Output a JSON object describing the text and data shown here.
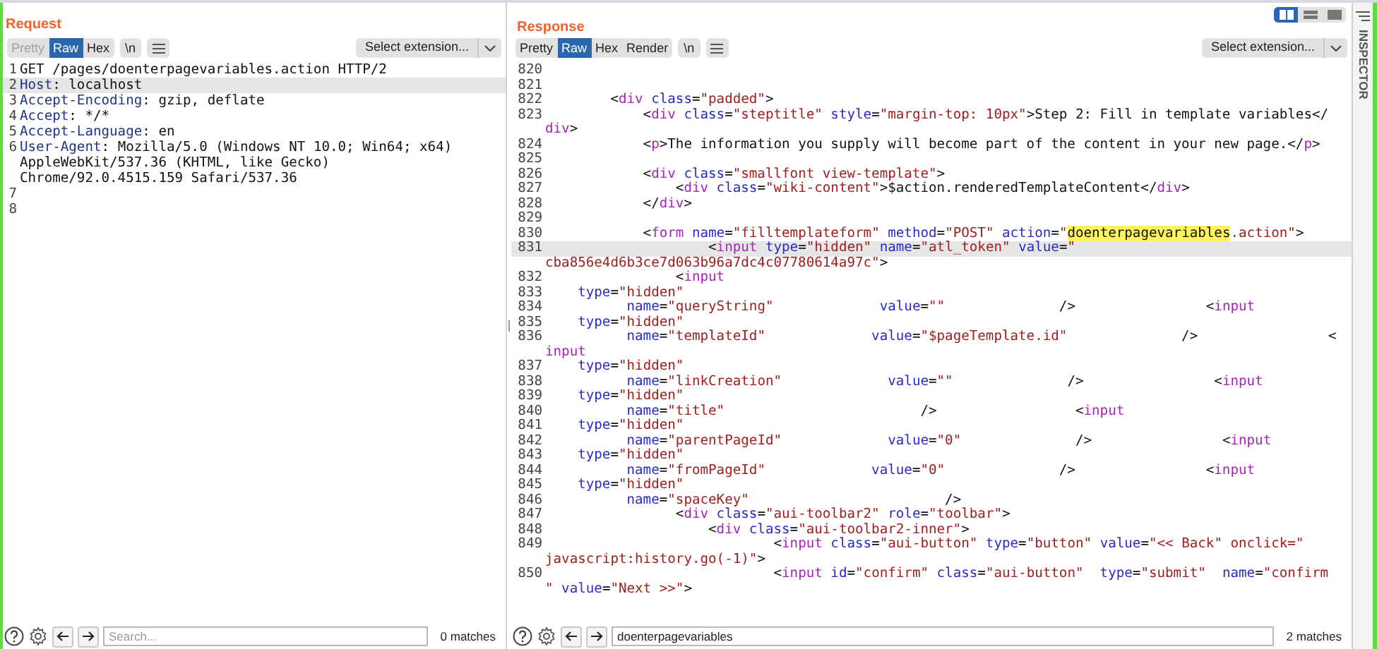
{
  "request": {
    "title": "Request",
    "view_tabs": [
      {
        "label": "Pretty",
        "selected": false,
        "disabled": true
      },
      {
        "label": "Raw",
        "selected": true,
        "disabled": false
      },
      {
        "label": "Hex",
        "selected": false,
        "disabled": false
      }
    ],
    "newline_button": "\\n",
    "extension_select": "Select extension...",
    "lines": [
      {
        "number": "1",
        "current": false,
        "rows": [
          {
            "tokens": [
              {
                "kind": "plain",
                "text": "GET /pages/doenterpagevariables.action HTTP/2"
              }
            ]
          }
        ]
      },
      {
        "number": "2",
        "current": true,
        "rows": [
          {
            "tokens": [
              {
                "kind": "header",
                "text": "Host"
              },
              {
                "kind": "plain",
                "text": ": localhost"
              }
            ]
          }
        ]
      },
      {
        "number": "3",
        "current": false,
        "rows": [
          {
            "tokens": [
              {
                "kind": "header",
                "text": "Accept-Encoding"
              },
              {
                "kind": "plain",
                "text": ": gzip, deflate"
              }
            ]
          }
        ]
      },
      {
        "number": "4",
        "current": false,
        "rows": [
          {
            "tokens": [
              {
                "kind": "header",
                "text": "Accept"
              },
              {
                "kind": "plain",
                "text": ": */*"
              }
            ]
          }
        ]
      },
      {
        "number": "5",
        "current": false,
        "rows": [
          {
            "tokens": [
              {
                "kind": "header",
                "text": "Accept-Language"
              },
              {
                "kind": "plain",
                "text": ": en"
              }
            ]
          }
        ]
      },
      {
        "number": "6",
        "current": false,
        "rows": [
          {
            "tokens": [
              {
                "kind": "header",
                "text": "User-Agent"
              },
              {
                "kind": "plain",
                "text": ": Mozilla/5.0 (Windows NT 10.0; Win64; x64)"
              }
            ]
          },
          {
            "tokens": [
              {
                "kind": "plain",
                "text": "AppleWebKit/537.36 (KHTML, like Gecko)"
              }
            ]
          },
          {
            "tokens": [
              {
                "kind": "plain",
                "text": "Chrome/92.0.4515.159 Safari/537.36"
              }
            ]
          }
        ]
      },
      {
        "number": "7",
        "current": false
      },
      {
        "number": "8",
        "current": false
      }
    ],
    "search": {
      "placeholder": "Search...",
      "matches": "0 matches"
    }
  },
  "response": {
    "title": "Response",
    "layout_buttons": [
      {
        "kind": "columns",
        "selected": true
      },
      {
        "kind": "rows",
        "selected": false
      },
      {
        "kind": "single",
        "selected": false
      }
    ],
    "view_tabs": [
      {
        "label": "Pretty",
        "selected": false,
        "disabled": false
      },
      {
        "label": "Raw",
        "selected": true,
        "disabled": false
      },
      {
        "label": "Hex",
        "selected": false,
        "disabled": false
      },
      {
        "label": "Render",
        "selected": false,
        "disabled": false
      }
    ],
    "newline_button": "\\n",
    "extension_select": "Select extension...",
    "lines": [
      {
        "number": "820",
        "current": false
      },
      {
        "number": "821",
        "current": false
      },
      {
        "number": "822",
        "current": false,
        "rows": [
          {
            "tokens": [
              {
                "kind": "plain",
                "text": "        <"
              },
              {
                "kind": "tag",
                "text": "div"
              },
              {
                "kind": "attr",
                "text": " class"
              },
              {
                "kind": "plain",
                "text": "="
              },
              {
                "kind": "string",
                "text": "\"padded\""
              },
              {
                "kind": "plain",
                "text": ">"
              }
            ]
          }
        ]
      },
      {
        "number": "823",
        "current": false,
        "rows": [
          {
            "tokens": [
              {
                "kind": "plain",
                "text": "            <"
              },
              {
                "kind": "tag",
                "text": "div"
              },
              {
                "kind": "attr",
                "text": " class"
              },
              {
                "kind": "plain",
                "text": "="
              },
              {
                "kind": "string",
                "text": "\"steptitle\""
              },
              {
                "kind": "attr",
                "text": " style"
              },
              {
                "kind": "plain",
                "text": "="
              },
              {
                "kind": "string",
                "text": "\"margin-top: 10px\""
              },
              {
                "kind": "plain",
                "text": ">Step 2: Fill in template variables</"
              }
            ]
          },
          {
            "tokens": [
              {
                "kind": "tag",
                "text": "div"
              },
              {
                "kind": "plain",
                "text": ">"
              }
            ]
          }
        ]
      },
      {
        "number": "824",
        "current": false,
        "rows": [
          {
            "tokens": [
              {
                "kind": "plain",
                "text": "            <"
              },
              {
                "kind": "tag",
                "text": "p"
              },
              {
                "kind": "plain",
                "text": ">The information you supply will become part of the content in your new page.</"
              },
              {
                "kind": "tag",
                "text": "p"
              },
              {
                "kind": "plain",
                "text": ">"
              }
            ]
          }
        ]
      },
      {
        "number": "825",
        "current": false
      },
      {
        "number": "826",
        "current": false,
        "rows": [
          {
            "tokens": [
              {
                "kind": "plain",
                "text": "            <"
              },
              {
                "kind": "tag",
                "text": "div"
              },
              {
                "kind": "attr",
                "text": " class"
              },
              {
                "kind": "plain",
                "text": "="
              },
              {
                "kind": "string",
                "text": "\"smallfont view-template\""
              },
              {
                "kind": "plain",
                "text": ">"
              }
            ]
          }
        ]
      },
      {
        "number": "827",
        "current": false,
        "rows": [
          {
            "tokens": [
              {
                "kind": "plain",
                "text": "                <"
              },
              {
                "kind": "tag",
                "text": "div"
              },
              {
                "kind": "attr",
                "text": " class"
              },
              {
                "kind": "plain",
                "text": "="
              },
              {
                "kind": "string",
                "text": "\"wiki-content\""
              },
              {
                "kind": "plain",
                "text": ">$action.renderedTemplateContent</"
              },
              {
                "kind": "tag",
                "text": "div"
              },
              {
                "kind": "plain",
                "text": ">"
              }
            ]
          }
        ]
      },
      {
        "number": "828",
        "current": false,
        "rows": [
          {
            "tokens": [
              {
                "kind": "plain",
                "text": "            </"
              },
              {
                "kind": "tag",
                "text": "div"
              },
              {
                "kind": "plain",
                "text": ">"
              }
            ]
          }
        ]
      },
      {
        "number": "829",
        "current": false
      },
      {
        "number": "830",
        "current": false,
        "rows": [
          {
            "tokens": [
              {
                "kind": "plain",
                "text": "            <"
              },
              {
                "kind": "tag",
                "text": "form"
              },
              {
                "kind": "attr",
                "text": " name"
              },
              {
                "kind": "plain",
                "text": "="
              },
              {
                "kind": "string",
                "text": "\"filltemplateform\""
              },
              {
                "kind": "attr",
                "text": " method"
              },
              {
                "kind": "plain",
                "text": "="
              },
              {
                "kind": "string",
                "text": "\"POST\""
              },
              {
                "kind": "attr",
                "text": " action"
              },
              {
                "kind": "plain",
                "text": "="
              },
              {
                "kind": "string",
                "text": "\""
              },
              {
                "kind": "match",
                "text": "doenterpagevariables"
              },
              {
                "kind": "string",
                "text": ".action\""
              },
              {
                "kind": "plain",
                "text": ">"
              }
            ]
          }
        ]
      },
      {
        "number": "831",
        "current": true,
        "rows": [
          {
            "tokens": [
              {
                "kind": "plain",
                "text": "                    <"
              },
              {
                "kind": "tag",
                "text": "input"
              },
              {
                "kind": "attr",
                "text": " type"
              },
              {
                "kind": "plain",
                "text": "="
              },
              {
                "kind": "string",
                "text": "\"hidden\""
              },
              {
                "kind": "attr",
                "text": " name"
              },
              {
                "kind": "plain",
                "text": "="
              },
              {
                "kind": "string",
                "text": "\"atl_token\""
              },
              {
                "kind": "attr",
                "text": " value"
              },
              {
                "kind": "plain",
                "text": "="
              },
              {
                "kind": "string",
                "text": "\""
              }
            ]
          },
          {
            "tokens": [
              {
                "kind": "string",
                "text": "cba856e4d6b3ce7d063b96a7dc4c07780614a97c\""
              },
              {
                "kind": "plain",
                "text": ">"
              }
            ]
          }
        ]
      },
      {
        "number": "832",
        "current": false,
        "rows": [
          {
            "tokens": [
              {
                "kind": "plain",
                "text": "                <"
              },
              {
                "kind": "tag",
                "text": "input"
              }
            ]
          }
        ]
      },
      {
        "number": "833",
        "current": false,
        "rows": [
          {
            "tokens": [
              {
                "kind": "attr",
                "text": "    type"
              },
              {
                "kind": "plain",
                "text": "="
              },
              {
                "kind": "string",
                "text": "\"hidden\""
              }
            ]
          }
        ]
      },
      {
        "number": "834",
        "current": false,
        "rows": [
          {
            "tokens": [
              {
                "kind": "attr",
                "text": "          name"
              },
              {
                "kind": "plain",
                "text": "="
              },
              {
                "kind": "string",
                "text": "\"queryString\""
              },
              {
                "kind": "attr",
                "text": "             value"
              },
              {
                "kind": "plain",
                "text": "="
              },
              {
                "kind": "string",
                "text": "\"\""
              },
              {
                "kind": "plain",
                "text": "              />                <"
              },
              {
                "kind": "tag",
                "text": "input"
              }
            ]
          }
        ]
      },
      {
        "number": "835",
        "current": false,
        "rows": [
          {
            "tokens": [
              {
                "kind": "attr",
                "text": "    type"
              },
              {
                "kind": "plain",
                "text": "="
              },
              {
                "kind": "string",
                "text": "\"hidden\""
              }
            ]
          }
        ]
      },
      {
        "number": "836",
        "current": false,
        "rows": [
          {
            "tokens": [
              {
                "kind": "attr",
                "text": "          name"
              },
              {
                "kind": "plain",
                "text": "="
              },
              {
                "kind": "string",
                "text": "\"templateId\""
              },
              {
                "kind": "attr",
                "text": "             value"
              },
              {
                "kind": "plain",
                "text": "="
              },
              {
                "kind": "string",
                "text": "\"$pageTemplate.id\""
              },
              {
                "kind": "plain",
                "text": "              />                <"
              }
            ]
          },
          {
            "tokens": [
              {
                "kind": "tag",
                "text": "input"
              }
            ]
          }
        ]
      },
      {
        "number": "837",
        "current": false,
        "rows": [
          {
            "tokens": [
              {
                "kind": "attr",
                "text": "    type"
              },
              {
                "kind": "plain",
                "text": "="
              },
              {
                "kind": "string",
                "text": "\"hidden\""
              }
            ]
          }
        ]
      },
      {
        "number": "838",
        "current": false,
        "rows": [
          {
            "tokens": [
              {
                "kind": "attr",
                "text": "          name"
              },
              {
                "kind": "plain",
                "text": "="
              },
              {
                "kind": "string",
                "text": "\"linkCreation\""
              },
              {
                "kind": "attr",
                "text": "             value"
              },
              {
                "kind": "plain",
                "text": "="
              },
              {
                "kind": "string",
                "text": "\"\""
              },
              {
                "kind": "plain",
                "text": "              />                <"
              },
              {
                "kind": "tag",
                "text": "input"
              }
            ]
          }
        ]
      },
      {
        "number": "839",
        "current": false,
        "rows": [
          {
            "tokens": [
              {
                "kind": "attr",
                "text": "    type"
              },
              {
                "kind": "plain",
                "text": "="
              },
              {
                "kind": "string",
                "text": "\"hidden\""
              }
            ]
          }
        ]
      },
      {
        "number": "840",
        "current": false,
        "rows": [
          {
            "tokens": [
              {
                "kind": "attr",
                "text": "          name"
              },
              {
                "kind": "plain",
                "text": "="
              },
              {
                "kind": "string",
                "text": "\"title\""
              },
              {
                "kind": "plain",
                "text": "                        />                 <"
              },
              {
                "kind": "tag",
                "text": "input"
              }
            ]
          }
        ]
      },
      {
        "number": "841",
        "current": false,
        "rows": [
          {
            "tokens": [
              {
                "kind": "attr",
                "text": "    type"
              },
              {
                "kind": "plain",
                "text": "="
              },
              {
                "kind": "string",
                "text": "\"hidden\""
              }
            ]
          }
        ]
      },
      {
        "number": "842",
        "current": false,
        "rows": [
          {
            "tokens": [
              {
                "kind": "attr",
                "text": "          name"
              },
              {
                "kind": "plain",
                "text": "="
              },
              {
                "kind": "string",
                "text": "\"parentPageId\""
              },
              {
                "kind": "attr",
                "text": "             value"
              },
              {
                "kind": "plain",
                "text": "="
              },
              {
                "kind": "string",
                "text": "\"0\""
              },
              {
                "kind": "plain",
                "text": "              />                <"
              },
              {
                "kind": "tag",
                "text": "input"
              }
            ]
          }
        ]
      },
      {
        "number": "843",
        "current": false,
        "rows": [
          {
            "tokens": [
              {
                "kind": "attr",
                "text": "    type"
              },
              {
                "kind": "plain",
                "text": "="
              },
              {
                "kind": "string",
                "text": "\"hidden\""
              }
            ]
          }
        ]
      },
      {
        "number": "844",
        "current": false,
        "rows": [
          {
            "tokens": [
              {
                "kind": "attr",
                "text": "          name"
              },
              {
                "kind": "plain",
                "text": "="
              },
              {
                "kind": "string",
                "text": "\"fromPageId\""
              },
              {
                "kind": "attr",
                "text": "             value"
              },
              {
                "kind": "plain",
                "text": "="
              },
              {
                "kind": "string",
                "text": "\"0\""
              },
              {
                "kind": "plain",
                "text": "              />                <"
              },
              {
                "kind": "tag",
                "text": "input"
              }
            ]
          }
        ]
      },
      {
        "number": "845",
        "current": false,
        "rows": [
          {
            "tokens": [
              {
                "kind": "attr",
                "text": "    type"
              },
              {
                "kind": "plain",
                "text": "="
              },
              {
                "kind": "string",
                "text": "\"hidden\""
              }
            ]
          }
        ]
      },
      {
        "number": "846",
        "current": false,
        "rows": [
          {
            "tokens": [
              {
                "kind": "attr",
                "text": "          name"
              },
              {
                "kind": "plain",
                "text": "="
              },
              {
                "kind": "string",
                "text": "\"spaceKey\""
              },
              {
                "kind": "plain",
                "text": "                        />"
              }
            ]
          }
        ]
      },
      {
        "number": "847",
        "current": false,
        "rows": [
          {
            "tokens": [
              {
                "kind": "plain",
                "text": "                <"
              },
              {
                "kind": "tag",
                "text": "div"
              },
              {
                "kind": "attr",
                "text": " class"
              },
              {
                "kind": "plain",
                "text": "="
              },
              {
                "kind": "string",
                "text": "\"aui-toolbar2\""
              },
              {
                "kind": "attr",
                "text": " role"
              },
              {
                "kind": "plain",
                "text": "="
              },
              {
                "kind": "string",
                "text": "\"toolbar\""
              },
              {
                "kind": "plain",
                "text": ">"
              }
            ]
          }
        ]
      },
      {
        "number": "848",
        "current": false,
        "rows": [
          {
            "tokens": [
              {
                "kind": "plain",
                "text": "                    <"
              },
              {
                "kind": "tag",
                "text": "div"
              },
              {
                "kind": "attr",
                "text": " class"
              },
              {
                "kind": "plain",
                "text": "="
              },
              {
                "kind": "string",
                "text": "\"aui-toolbar2-inner\""
              },
              {
                "kind": "plain",
                "text": ">"
              }
            ]
          }
        ]
      },
      {
        "number": "849",
        "current": false,
        "rows": [
          {
            "tokens": [
              {
                "kind": "plain",
                "text": "                            <"
              },
              {
                "kind": "tag",
                "text": "input"
              },
              {
                "kind": "attr",
                "text": " class"
              },
              {
                "kind": "plain",
                "text": "="
              },
              {
                "kind": "string",
                "text": "\"aui-button\""
              },
              {
                "kind": "attr",
                "text": " type"
              },
              {
                "kind": "plain",
                "text": "="
              },
              {
                "kind": "string",
                "text": "\"button\""
              },
              {
                "kind": "attr",
                "text": " value"
              },
              {
                "kind": "plain",
                "text": "="
              },
              {
                "kind": "string",
                "text": "\"<< Back\" onclick=\""
              }
            ]
          },
          {
            "tokens": [
              {
                "kind": "string",
                "text": "javascript:history.go(-1)\""
              },
              {
                "kind": "plain",
                "text": ">"
              }
            ]
          }
        ]
      },
      {
        "number": "850",
        "current": false,
        "rows": [
          {
            "tokens": [
              {
                "kind": "plain",
                "text": "                            <"
              },
              {
                "kind": "tag",
                "text": "input"
              },
              {
                "kind": "attr",
                "text": " id"
              },
              {
                "kind": "plain",
                "text": "="
              },
              {
                "kind": "string",
                "text": "\"confirm\""
              },
              {
                "kind": "attr",
                "text": " class"
              },
              {
                "kind": "plain",
                "text": "="
              },
              {
                "kind": "string",
                "text": "\"aui-button\""
              },
              {
                "kind": "attr",
                "text": "  type"
              },
              {
                "kind": "plain",
                "text": "="
              },
              {
                "kind": "string",
                "text": "\"submit\""
              },
              {
                "kind": "attr",
                "text": "  name"
              },
              {
                "kind": "plain",
                "text": "="
              },
              {
                "kind": "string",
                "text": "\"confirm"
              }
            ]
          },
          {
            "tokens": [
              {
                "kind": "string",
                "text": "\""
              },
              {
                "kind": "attr",
                "text": " value"
              },
              {
                "kind": "plain",
                "text": "="
              },
              {
                "kind": "string",
                "text": "\"Next >>\""
              },
              {
                "kind": "plain",
                "text": ">"
              }
            ]
          }
        ]
      }
    ],
    "search": {
      "value": "doenterpagevariables",
      "matches": "2 matches"
    }
  },
  "inspector": {
    "label": "INSPECTOR"
  }
}
